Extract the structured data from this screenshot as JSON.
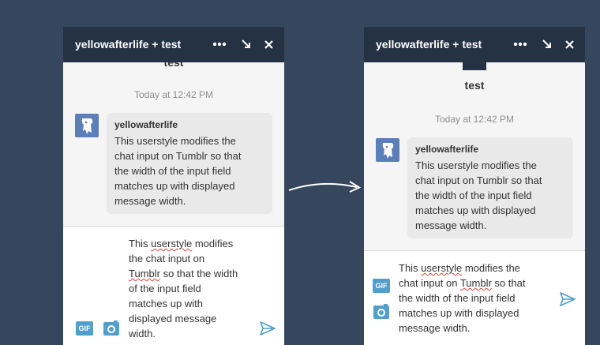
{
  "left_chat": {
    "title": "yellowafterlife + test",
    "participant_name": "test",
    "timestamp": "Today at 12:42 PM",
    "message": {
      "author": "yellowafterlife",
      "lines": [
        "This userstyle modifies the",
        "chat input on Tumblr so that",
        "the width of the input field",
        "matches up with displayed",
        "message width."
      ]
    },
    "input": {
      "line1a": "This ",
      "line1b": "userstyle",
      "line1c": " modifies",
      "line2": "the chat input on",
      "line3a": "Tumblr",
      "line3b": " so that the width",
      "line4": "of the input field",
      "line5": "matches up with",
      "line6": "displayed message",
      "line7": "width."
    },
    "gif_label": "GIF"
  },
  "right_chat": {
    "title": "yellowafterlife + test",
    "participant_name": "test",
    "timestamp": "Today at 12:42 PM",
    "message": {
      "author": "yellowafterlife",
      "lines": [
        "This userstyle modifies the",
        "chat input on Tumblr so that",
        "the width of the input field",
        "matches up with displayed",
        "message width."
      ]
    },
    "input": {
      "line1a": "This ",
      "line1b": "userstyle",
      "line1c": " modifies the",
      "line2a": "chat input on ",
      "line2b": "Tumblr",
      "line2c": " so that",
      "line3": "the width of the input field",
      "line4": "matches up with displayed",
      "line5": "message width."
    },
    "gif_label": "GIF"
  },
  "colors": {
    "background": "#36465d",
    "header": "#243243",
    "accent": "#529ecc",
    "bubble": "#e9e9e9"
  },
  "icons": [
    "more-icon",
    "minimize-icon",
    "close-icon",
    "gif-icon",
    "camera-icon",
    "send-icon",
    "arrow-icon"
  ]
}
